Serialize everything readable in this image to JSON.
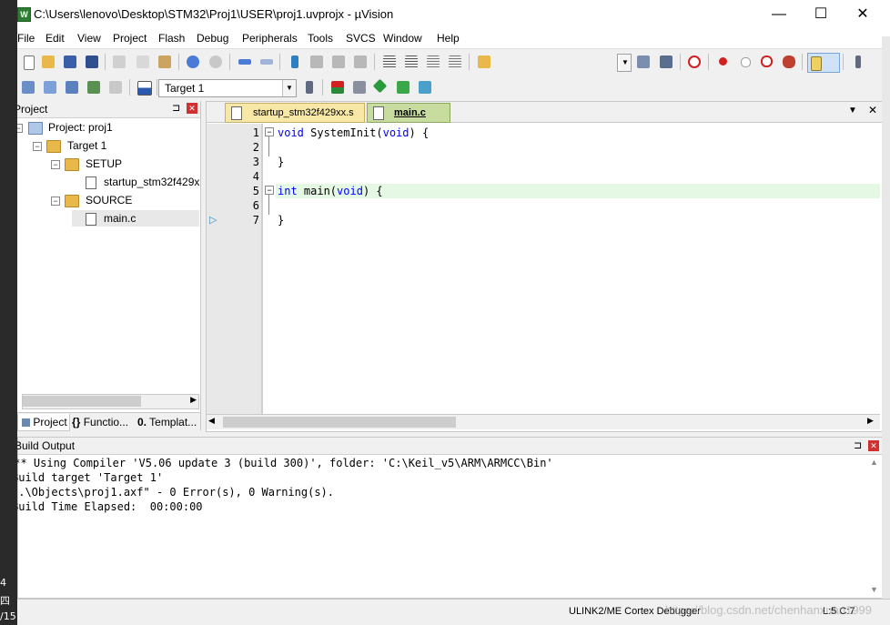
{
  "window": {
    "title": "C:\\Users\\lenovo\\Desktop\\STM32\\Proj1\\USER\\proj1.uvprojx - µVision",
    "minimize": "—",
    "maximize": "☐",
    "close": "✕"
  },
  "left_strip": {
    "items": [
      "4",
      "四",
      "/15"
    ]
  },
  "menu": [
    "File",
    "Edit",
    "View",
    "Project",
    "Flash",
    "Debug",
    "Peripherals",
    "Tools",
    "SVCS",
    "Window",
    "Help"
  ],
  "toolbar": {
    "target_combo": "Target 1"
  },
  "project_panel": {
    "title": "Project",
    "pin": "⊐",
    "close": "✕",
    "tree": {
      "root": "Project: proj1",
      "target": "Target 1",
      "groups": [
        {
          "name": "SETUP",
          "files": [
            "startup_stm32f429xx.s"
          ]
        },
        {
          "name": "SOURCE",
          "files": [
            "main.c"
          ]
        }
      ],
      "truncated_startup": "startup_stm32f429x"
    },
    "tabs": [
      "Project",
      "Functio...",
      "Templat..."
    ]
  },
  "editor": {
    "tabs": [
      {
        "label": "startup_stm32f429xx.s",
        "active": false
      },
      {
        "label": "main.c",
        "active": true
      }
    ],
    "lines": [
      {
        "num": "1",
        "code": "void SystemInit(void) {"
      },
      {
        "num": "2",
        "code": ""
      },
      {
        "num": "3",
        "code": "}"
      },
      {
        "num": "4",
        "code": ""
      },
      {
        "num": "5",
        "code": "int main(void) {"
      },
      {
        "num": "6",
        "code": ""
      },
      {
        "num": "7",
        "code": "}"
      }
    ],
    "current_line": 5
  },
  "build_output": {
    "title": "Build Output",
    "lines": [
      "*** Using Compiler 'V5.06 update 3 (build 300)', folder: 'C:\\Keil_v5\\ARM\\ARMCC\\Bin'",
      "Build target 'Target 1'",
      "\".\\Objects\\proj1.axf\" - 0 Error(s), 0 Warning(s).",
      "Build Time Elapsed:  00:00:00"
    ]
  },
  "status": {
    "debugger": "ULINK2/ME Cortex Debugger",
    "position": "L:5 C:7",
    "watermark": "https://blog.csdn.net/chenhanxuan1999"
  }
}
